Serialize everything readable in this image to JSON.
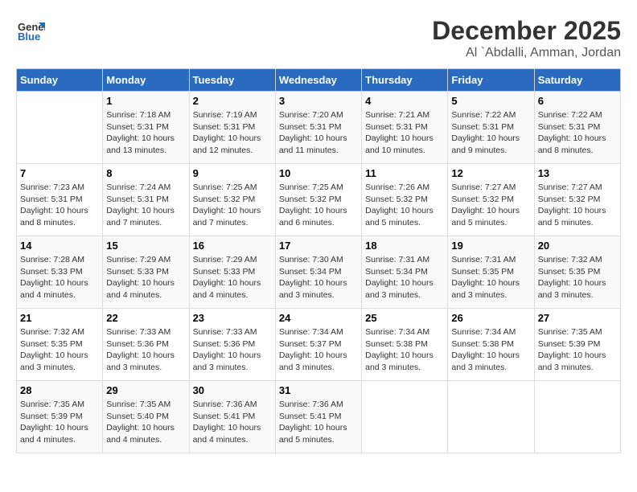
{
  "header": {
    "logo_general": "General",
    "logo_blue": "Blue",
    "month_title": "December 2025",
    "location": "Al `Abdalli, Amman, Jordan"
  },
  "weekdays": [
    "Sunday",
    "Monday",
    "Tuesday",
    "Wednesday",
    "Thursday",
    "Friday",
    "Saturday"
  ],
  "weeks": [
    [
      {
        "day": "",
        "info": ""
      },
      {
        "day": "1",
        "info": "Sunrise: 7:18 AM\nSunset: 5:31 PM\nDaylight: 10 hours\nand 13 minutes."
      },
      {
        "day": "2",
        "info": "Sunrise: 7:19 AM\nSunset: 5:31 PM\nDaylight: 10 hours\nand 12 minutes."
      },
      {
        "day": "3",
        "info": "Sunrise: 7:20 AM\nSunset: 5:31 PM\nDaylight: 10 hours\nand 11 minutes."
      },
      {
        "day": "4",
        "info": "Sunrise: 7:21 AM\nSunset: 5:31 PM\nDaylight: 10 hours\nand 10 minutes."
      },
      {
        "day": "5",
        "info": "Sunrise: 7:22 AM\nSunset: 5:31 PM\nDaylight: 10 hours\nand 9 minutes."
      },
      {
        "day": "6",
        "info": "Sunrise: 7:22 AM\nSunset: 5:31 PM\nDaylight: 10 hours\nand 8 minutes."
      }
    ],
    [
      {
        "day": "7",
        "info": "Sunrise: 7:23 AM\nSunset: 5:31 PM\nDaylight: 10 hours\nand 8 minutes."
      },
      {
        "day": "8",
        "info": "Sunrise: 7:24 AM\nSunset: 5:31 PM\nDaylight: 10 hours\nand 7 minutes."
      },
      {
        "day": "9",
        "info": "Sunrise: 7:25 AM\nSunset: 5:32 PM\nDaylight: 10 hours\nand 7 minutes."
      },
      {
        "day": "10",
        "info": "Sunrise: 7:25 AM\nSunset: 5:32 PM\nDaylight: 10 hours\nand 6 minutes."
      },
      {
        "day": "11",
        "info": "Sunrise: 7:26 AM\nSunset: 5:32 PM\nDaylight: 10 hours\nand 5 minutes."
      },
      {
        "day": "12",
        "info": "Sunrise: 7:27 AM\nSunset: 5:32 PM\nDaylight: 10 hours\nand 5 minutes."
      },
      {
        "day": "13",
        "info": "Sunrise: 7:27 AM\nSunset: 5:32 PM\nDaylight: 10 hours\nand 5 minutes."
      }
    ],
    [
      {
        "day": "14",
        "info": "Sunrise: 7:28 AM\nSunset: 5:33 PM\nDaylight: 10 hours\nand 4 minutes."
      },
      {
        "day": "15",
        "info": "Sunrise: 7:29 AM\nSunset: 5:33 PM\nDaylight: 10 hours\nand 4 minutes."
      },
      {
        "day": "16",
        "info": "Sunrise: 7:29 AM\nSunset: 5:33 PM\nDaylight: 10 hours\nand 4 minutes."
      },
      {
        "day": "17",
        "info": "Sunrise: 7:30 AM\nSunset: 5:34 PM\nDaylight: 10 hours\nand 3 minutes."
      },
      {
        "day": "18",
        "info": "Sunrise: 7:31 AM\nSunset: 5:34 PM\nDaylight: 10 hours\nand 3 minutes."
      },
      {
        "day": "19",
        "info": "Sunrise: 7:31 AM\nSunset: 5:35 PM\nDaylight: 10 hours\nand 3 minutes."
      },
      {
        "day": "20",
        "info": "Sunrise: 7:32 AM\nSunset: 5:35 PM\nDaylight: 10 hours\nand 3 minutes."
      }
    ],
    [
      {
        "day": "21",
        "info": "Sunrise: 7:32 AM\nSunset: 5:35 PM\nDaylight: 10 hours\nand 3 minutes."
      },
      {
        "day": "22",
        "info": "Sunrise: 7:33 AM\nSunset: 5:36 PM\nDaylight: 10 hours\nand 3 minutes."
      },
      {
        "day": "23",
        "info": "Sunrise: 7:33 AM\nSunset: 5:36 PM\nDaylight: 10 hours\nand 3 minutes."
      },
      {
        "day": "24",
        "info": "Sunrise: 7:34 AM\nSunset: 5:37 PM\nDaylight: 10 hours\nand 3 minutes."
      },
      {
        "day": "25",
        "info": "Sunrise: 7:34 AM\nSunset: 5:38 PM\nDaylight: 10 hours\nand 3 minutes."
      },
      {
        "day": "26",
        "info": "Sunrise: 7:34 AM\nSunset: 5:38 PM\nDaylight: 10 hours\nand 3 minutes."
      },
      {
        "day": "27",
        "info": "Sunrise: 7:35 AM\nSunset: 5:39 PM\nDaylight: 10 hours\nand 3 minutes."
      }
    ],
    [
      {
        "day": "28",
        "info": "Sunrise: 7:35 AM\nSunset: 5:39 PM\nDaylight: 10 hours\nand 4 minutes."
      },
      {
        "day": "29",
        "info": "Sunrise: 7:35 AM\nSunset: 5:40 PM\nDaylight: 10 hours\nand 4 minutes."
      },
      {
        "day": "30",
        "info": "Sunrise: 7:36 AM\nSunset: 5:41 PM\nDaylight: 10 hours\nand 4 minutes."
      },
      {
        "day": "31",
        "info": "Sunrise: 7:36 AM\nSunset: 5:41 PM\nDaylight: 10 hours\nand 5 minutes."
      },
      {
        "day": "",
        "info": ""
      },
      {
        "day": "",
        "info": ""
      },
      {
        "day": "",
        "info": ""
      }
    ]
  ]
}
